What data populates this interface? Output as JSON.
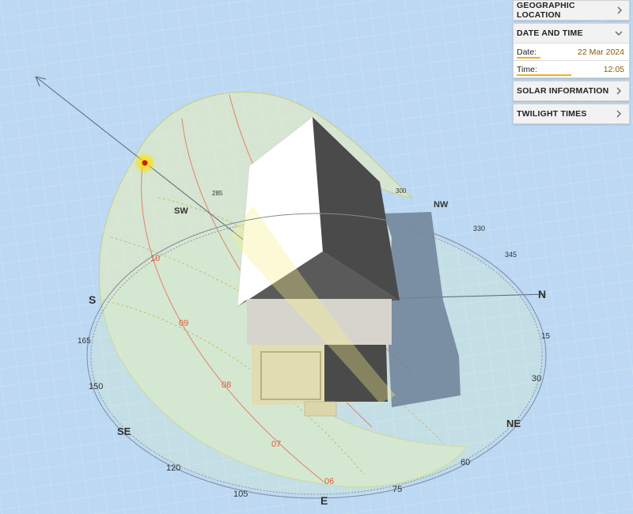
{
  "panel": {
    "sections": [
      {
        "title": "GEOGRAPHIC LOCATION",
        "expanded": false
      },
      {
        "title": "DATE AND TIME",
        "expanded": true
      },
      {
        "title": "SOLAR INFORMATION",
        "expanded": false
      },
      {
        "title": "TWILIGHT TIMES",
        "expanded": false
      }
    ],
    "date": {
      "label": "Date:",
      "value": "22 Mar 2024",
      "slider_fraction": 0.22
    },
    "time": {
      "label": "Time:",
      "value": "12:05",
      "slider_fraction": 0.5
    }
  },
  "compass": {
    "cardinals": [
      "N",
      "S",
      "E",
      "NE",
      "SE",
      "NW",
      "SW"
    ],
    "bearings": [
      "15",
      "30",
      "60",
      "75",
      "105",
      "120",
      "150",
      "165",
      "285",
      "300",
      "330",
      "345"
    ],
    "hours": [
      "10",
      "09",
      "08",
      "07",
      "06"
    ]
  },
  "colors": {
    "ground": "#bcd8f2",
    "grid": "#d4e6f8",
    "sun_path_fill": "#e9f1b8",
    "hour_lines": "#e45a3a",
    "accent": "#f0b020",
    "value_text": "#8a5a00"
  }
}
